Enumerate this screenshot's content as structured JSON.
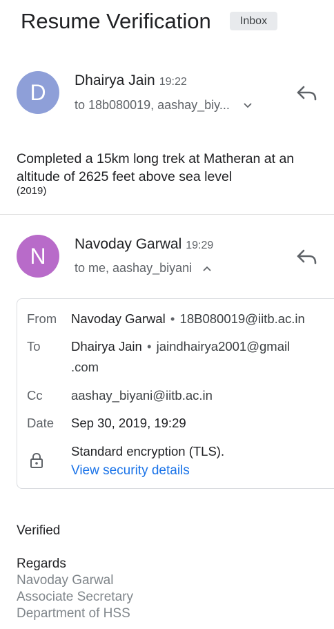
{
  "subject": "Resume Verification",
  "label_badge": "Inbox",
  "messages": [
    {
      "avatar_letter": "D",
      "avatar_color": "#8e9fd8",
      "sender": "Dhairya Jain",
      "time": "19:22",
      "recipients": "to 18b080019, aashay_biy...",
      "body_line1": "Completed a 15km long trek at Matheran at an",
      "body_line2": "altitude of 2625 feet above sea level",
      "body_small": "(2019)"
    },
    {
      "avatar_letter": "N",
      "avatar_color": "#b86bc9",
      "sender": "Navoday Garwal",
      "time": "19:29",
      "recipients": "to me, aashay_biyani"
    }
  ],
  "details": {
    "from_label": "From",
    "from_name": "Navoday Garwal",
    "from_email": "18B080019@iitb.ac.in",
    "to_label": "To",
    "to_name": "Dhairya Jain",
    "to_email_line1": "jaindhairya2001@gmail",
    "to_email_line2": ".com",
    "cc_label": "Cc",
    "cc_value": "aashay_biyani@iitb.ac.in",
    "date_label": "Date",
    "date_value": "Sep 30, 2019, 19:29",
    "encryption": "Standard encryption (TLS).",
    "security_link": "View security details"
  },
  "message_body": {
    "verified": "Verified",
    "regards": "Regards",
    "sig_name": "Navoday Garwal",
    "sig_title": "Associate Secretary",
    "sig_dept": "Department of HSS"
  },
  "icons": {
    "reply": "reply-icon",
    "expand": "chevron-down-icon",
    "collapse": "chevron-up-icon",
    "lock": "lock-icon"
  },
  "colors": {
    "link": "#1a73e8",
    "badge_bg": "#e8eaed"
  }
}
